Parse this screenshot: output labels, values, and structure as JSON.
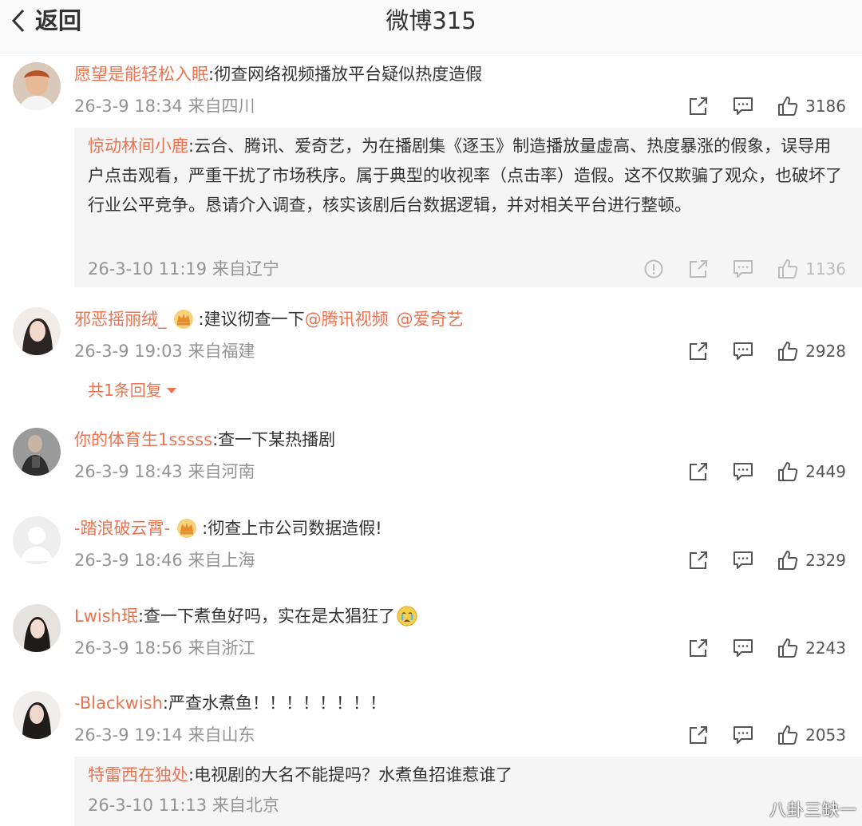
{
  "header": {
    "back_label": "返回",
    "title": "微博315"
  },
  "colors": {
    "username": "#eb7350",
    "meta": "#939393",
    "reply_bg": "#f5f5f5",
    "header_bg": "#fafafa"
  },
  "icons": {
    "back": "chevron-left-icon",
    "share": "share-icon",
    "comment": "comment-icon",
    "like": "thumbs-up-icon",
    "report": "report-icon",
    "crown_badge": "crown-badge-icon",
    "crying_emoji": "crying-face-emoji"
  },
  "comments": [
    {
      "username": "愿望是能轻松入眠",
      "text": ":彻查网络视频播放平台疑似热度造假",
      "meta": "26-3-9 18:34 来自四川",
      "likes": "3186",
      "reply": {
        "username": "惊动林间小鹿",
        "text": ":云合、腾讯、爱奇艺，为在播剧集《逐玉》制造播放量虚高、热度暴涨的假象，误导用户点击观看，严重干扰了市场秩序。属于典型的收视率（点击率）造假。这不仅欺骗了观众，也破坏了行业公平竞争。恳请介入调查，核实该剧后台数据逻辑，并对相关平台进行整顿。",
        "meta": "26-3-10 11:19 来自辽宁",
        "likes": "1136"
      }
    },
    {
      "username": "邪恶摇丽绒_",
      "text": ":建议彻查一下",
      "mention1": "@腾讯视频",
      "mention2": "@爱奇艺",
      "meta": "26-3-9 19:03 来自福建",
      "likes": "2928",
      "reply_count": "共1条回复"
    },
    {
      "username": "你的体育生1sssss",
      "text": ":查一下某热播剧",
      "meta": "26-3-9 18:43 来自河南",
      "likes": "2449"
    },
    {
      "username": "-踏浪破云霄-",
      "text": ":彻查上市公司数据造假!",
      "meta": "26-3-9 18:46 来自上海",
      "likes": "2329"
    },
    {
      "username": "Lwish珉",
      "text": ":查一下煮鱼好吗，实在是太猖狂了",
      "meta": "26-3-9 18:56 来自浙江",
      "likes": "2243"
    },
    {
      "username": "-Blackwish",
      "text": ":严查水煮鱼！！！！！！！！",
      "meta": "26-3-9 19:14 来自山东",
      "likes": "2053",
      "reply": {
        "username": "特雷西在独处",
        "text": ":电视剧的大名不能提吗？水煮鱼招谁惹谁了",
        "meta": "26-3-10 11:13 来自北京"
      }
    }
  ],
  "watermark": "八卦三缺一"
}
